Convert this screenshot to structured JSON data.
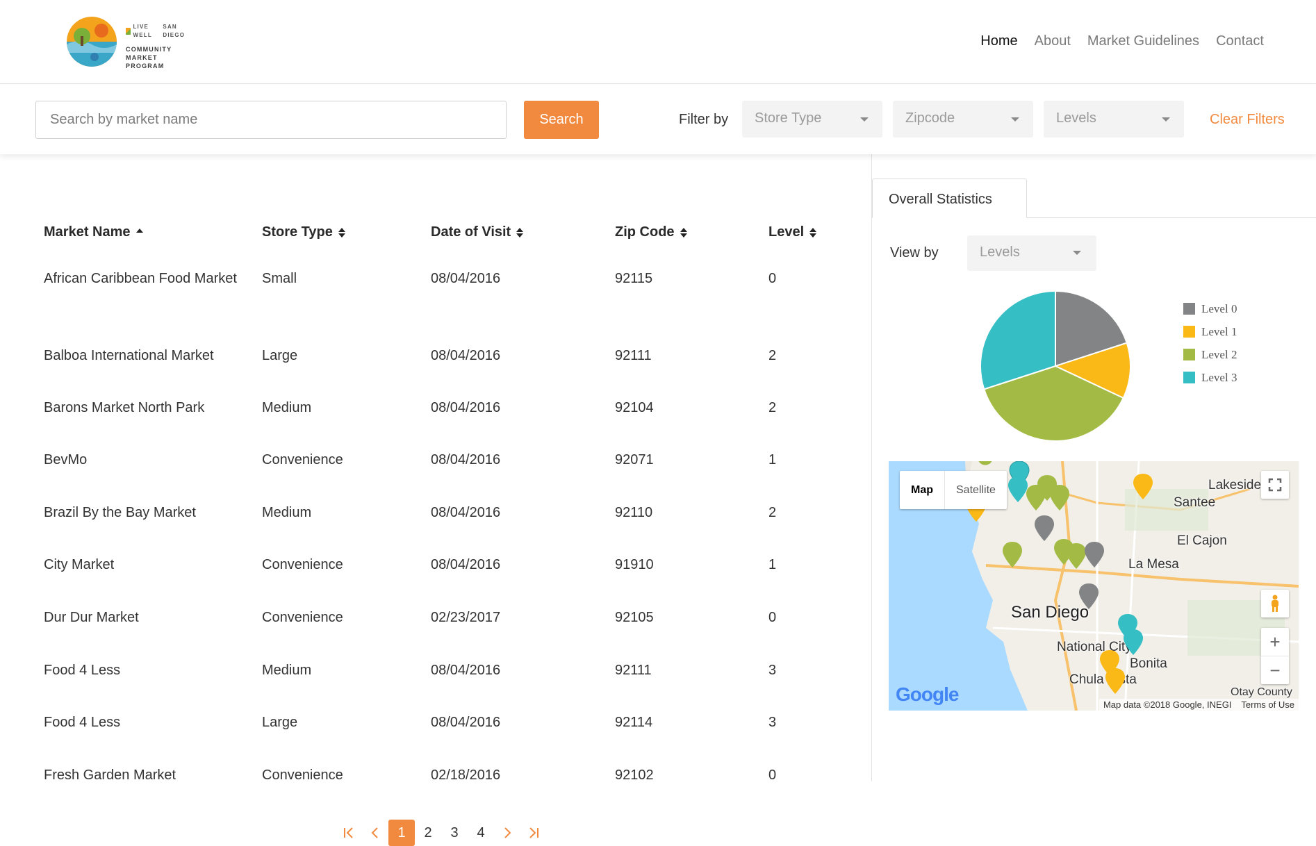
{
  "header": {
    "logo_brand": "LIVE WELL",
    "logo_brand_sub": "SAN DIEGO",
    "logo_lines": [
      "COMMUNITY",
      "MARKET",
      "PROGRAM"
    ],
    "nav": [
      "Home",
      "About",
      "Market Guidelines",
      "Contact"
    ]
  },
  "filters": {
    "search_placeholder": "Search by market name",
    "search_button": "Search",
    "filter_label": "Filter by",
    "store_type": "Store Type",
    "zipcode": "Zipcode",
    "levels": "Levels",
    "clear": "Clear Filters"
  },
  "table": {
    "columns": [
      "Market Name",
      "Store Type",
      "Date of Visit",
      "Zip Code",
      "Level"
    ],
    "rows": [
      [
        "African Caribbean Food Market",
        "Small",
        "08/04/2016",
        "92115",
        "0"
      ],
      [
        "Balboa International Market",
        "Large",
        "08/04/2016",
        "92111",
        "2"
      ],
      [
        "Barons Market North Park",
        "Medium",
        "08/04/2016",
        "92104",
        "2"
      ],
      [
        "BevMo",
        "Convenience",
        "08/04/2016",
        "92071",
        "1"
      ],
      [
        "Brazil By the Bay Market",
        "Medium",
        "08/04/2016",
        "92110",
        "2"
      ],
      [
        "City Market",
        "Convenience",
        "08/04/2016",
        "91910",
        "1"
      ],
      [
        "Dur Dur Market",
        "Convenience",
        "02/23/2017",
        "92105",
        "0"
      ],
      [
        "Food 4 Less",
        "Medium",
        "08/04/2016",
        "92111",
        "3"
      ],
      [
        "Food 4 Less",
        "Large",
        "08/04/2016",
        "92114",
        "3"
      ],
      [
        "Fresh Garden Market",
        "Convenience",
        "02/18/2016",
        "92102",
        "0"
      ]
    ]
  },
  "pagination": {
    "pages": [
      "1",
      "2",
      "3",
      "4"
    ],
    "current": "1"
  },
  "stats": {
    "tab": "Overall Statistics",
    "view_by": "View by",
    "view_by_value": "Levels"
  },
  "chart_data": {
    "type": "pie",
    "labels": [
      "Level 0",
      "Level 1",
      "Level 2",
      "Level 3"
    ],
    "values": [
      20,
      12,
      38,
      30
    ],
    "colors": [
      "#838486",
      "#fbb917",
      "#a3bb44",
      "#35bec4"
    ]
  },
  "map": {
    "toggle": [
      "Map",
      "Satellite"
    ],
    "places": [
      "Lakeside",
      "Santee",
      "El Cajon",
      "La Mesa",
      "San Diego",
      "National City",
      "Bonita",
      "Chula Vista",
      "Otay County"
    ],
    "attribution": "Map data ©2018 Google, INEGI",
    "terms": "Terms of Use",
    "logo": "Google"
  }
}
